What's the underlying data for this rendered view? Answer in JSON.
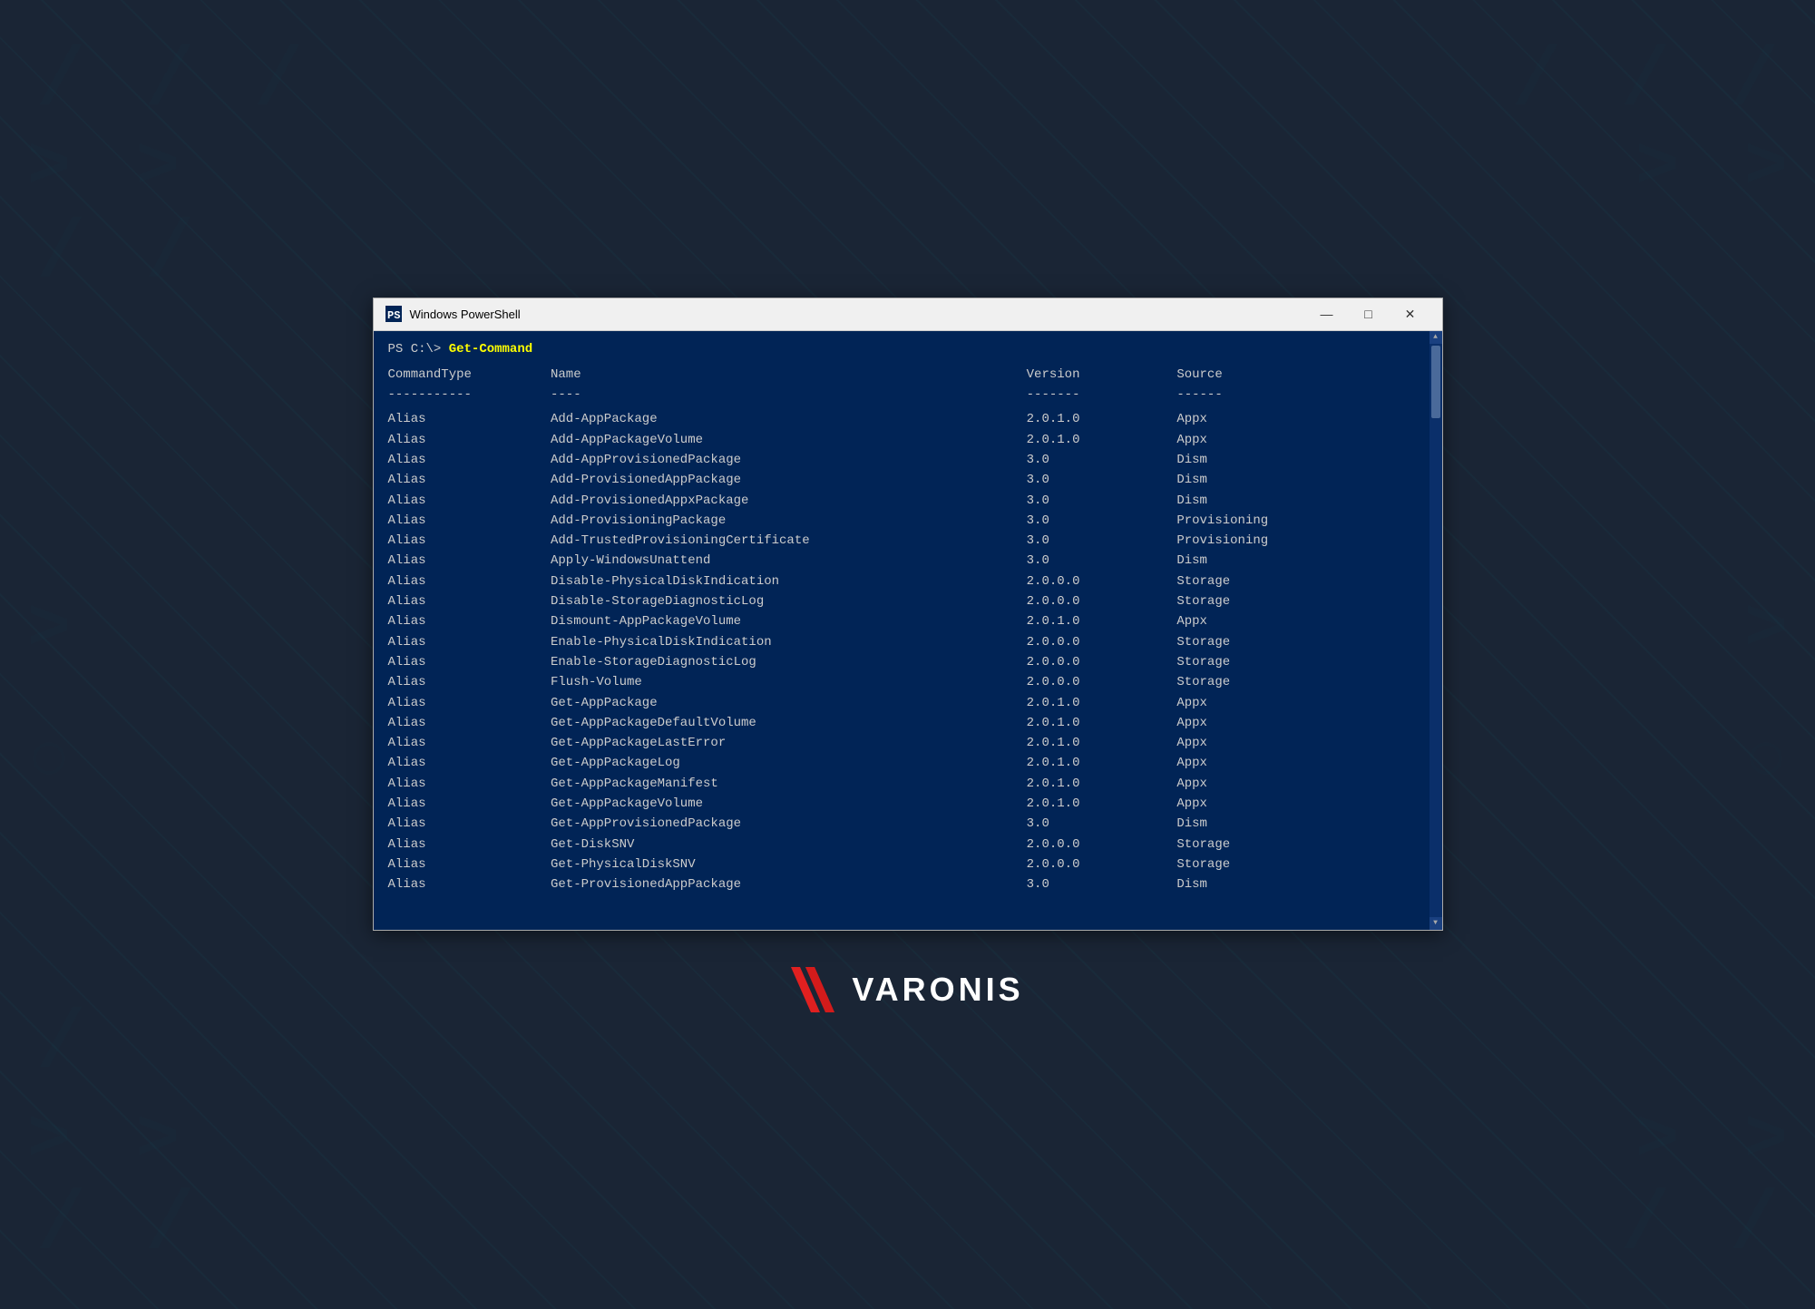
{
  "background": {
    "color": "#1a2535"
  },
  "window": {
    "title": "Windows PowerShell",
    "controls": {
      "minimize": "—",
      "maximize": "□",
      "close": "✕"
    }
  },
  "terminal": {
    "prompt": "PS C:\\> ",
    "command": "Get-Command",
    "columns": {
      "type": "CommandType",
      "name": "Name",
      "version": "Version",
      "source": "Source"
    },
    "separators": {
      "type": "-----------",
      "name": "----",
      "version": "-------",
      "source": "------"
    },
    "rows": [
      {
        "type": "Alias",
        "name": "Add-AppPackage",
        "version": "2.0.1.0",
        "source": "Appx"
      },
      {
        "type": "Alias",
        "name": "Add-AppPackageVolume",
        "version": "2.0.1.0",
        "source": "Appx"
      },
      {
        "type": "Alias",
        "name": "Add-AppProvisionedPackage",
        "version": "3.0",
        "source": "Dism"
      },
      {
        "type": "Alias",
        "name": "Add-ProvisionedAppPackage",
        "version": "3.0",
        "source": "Dism"
      },
      {
        "type": "Alias",
        "name": "Add-ProvisionedAppxPackage",
        "version": "3.0",
        "source": "Dism"
      },
      {
        "type": "Alias",
        "name": "Add-ProvisioningPackage",
        "version": "3.0",
        "source": "Provisioning"
      },
      {
        "type": "Alias",
        "name": "Add-TrustedProvisioningCertificate",
        "version": "3.0",
        "source": "Provisioning"
      },
      {
        "type": "Alias",
        "name": "Apply-WindowsUnattend",
        "version": "3.0",
        "source": "Dism"
      },
      {
        "type": "Alias",
        "name": "Disable-PhysicalDiskIndication",
        "version": "2.0.0.0",
        "source": "Storage"
      },
      {
        "type": "Alias",
        "name": "Disable-StorageDiagnosticLog",
        "version": "2.0.0.0",
        "source": "Storage"
      },
      {
        "type": "Alias",
        "name": "Dismount-AppPackageVolume",
        "version": "2.0.1.0",
        "source": "Appx"
      },
      {
        "type": "Alias",
        "name": "Enable-PhysicalDiskIndication",
        "version": "2.0.0.0",
        "source": "Storage"
      },
      {
        "type": "Alias",
        "name": "Enable-StorageDiagnosticLog",
        "version": "2.0.0.0",
        "source": "Storage"
      },
      {
        "type": "Alias",
        "name": "Flush-Volume",
        "version": "2.0.0.0",
        "source": "Storage"
      },
      {
        "type": "Alias",
        "name": "Get-AppPackage",
        "version": "2.0.1.0",
        "source": "Appx"
      },
      {
        "type": "Alias",
        "name": "Get-AppPackageDefaultVolume",
        "version": "2.0.1.0",
        "source": "Appx"
      },
      {
        "type": "Alias",
        "name": "Get-AppPackageLastError",
        "version": "2.0.1.0",
        "source": "Appx"
      },
      {
        "type": "Alias",
        "name": "Get-AppPackageLog",
        "version": "2.0.1.0",
        "source": "Appx"
      },
      {
        "type": "Alias",
        "name": "Get-AppPackageManifest",
        "version": "2.0.1.0",
        "source": "Appx"
      },
      {
        "type": "Alias",
        "name": "Get-AppPackageVolume",
        "version": "2.0.1.0",
        "source": "Appx"
      },
      {
        "type": "Alias",
        "name": "Get-AppProvisionedPackage",
        "version": "3.0",
        "source": "Dism"
      },
      {
        "type": "Alias",
        "name": "Get-DiskSNV",
        "version": "2.0.0.0",
        "source": "Storage"
      },
      {
        "type": "Alias",
        "name": "Get-PhysicalDiskSNV",
        "version": "2.0.0.0",
        "source": "Storage"
      },
      {
        "type": "Alias",
        "name": "Get-ProvisionedAppPackage",
        "version": "3.0",
        "source": "Dism"
      }
    ]
  },
  "varonis": {
    "text": "VARONIS"
  }
}
